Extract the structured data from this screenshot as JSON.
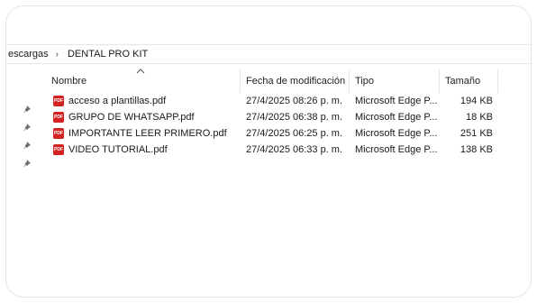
{
  "breadcrumb": {
    "parent": "escargas",
    "current": "DENTAL PRO KIT",
    "separator": "›"
  },
  "columns": {
    "name": "Nombre",
    "modified": "Fecha de modificación",
    "type": "Tipo",
    "size": "Tamaño"
  },
  "icons": {
    "sort": "sort-ascending-icon",
    "pin": "pin-icon",
    "file": "pdf-file-icon",
    "pdf_badge": "PDF"
  },
  "colors": {
    "pdf_red": "#d32222"
  },
  "files": [
    {
      "name": "acceso a plantillas.pdf",
      "modified": "27/4/2025 08:26 p. m.",
      "type": "Microsoft Edge P...",
      "size": "194 KB"
    },
    {
      "name": "GRUPO DE WHATSAPP.pdf",
      "modified": "27/4/2025 06:38 p. m.",
      "type": "Microsoft Edge P...",
      "size": "18 KB"
    },
    {
      "name": "IMPORTANTE LEER PRIMERO.pdf",
      "modified": "27/4/2025 06:25 p. m.",
      "type": "Microsoft Edge P...",
      "size": "251 KB"
    },
    {
      "name": "VIDEO TUTORIAL.pdf",
      "modified": "27/4/2025 06:33 p. m.",
      "type": "Microsoft Edge P...",
      "size": "138 KB"
    }
  ]
}
